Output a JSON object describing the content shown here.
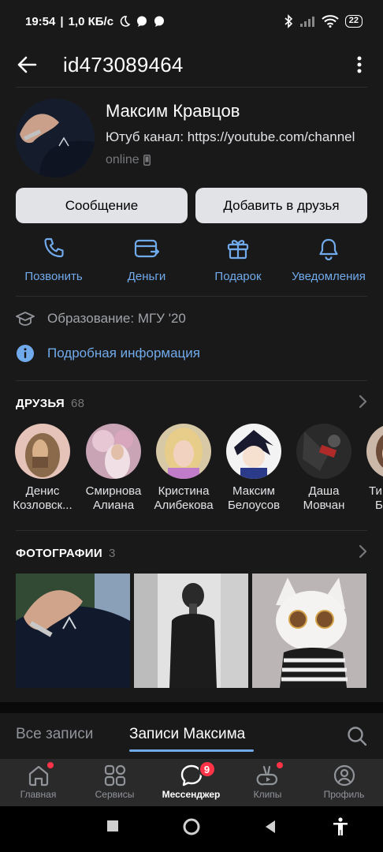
{
  "status_bar": {
    "time": "19:54",
    "speed": "1,0 КБ/с",
    "battery": "22"
  },
  "header": {
    "title": "id473089464"
  },
  "profile": {
    "name": "Максим Кравцов",
    "status": "Ютуб канал: https://youtube.com/channel",
    "online": "online"
  },
  "buttons": {
    "message": "Сообщение",
    "add_friend": "Добавить в друзья"
  },
  "actions": [
    {
      "label": "Позвонить",
      "icon": "phone-icon"
    },
    {
      "label": "Деньги",
      "icon": "money-icon"
    },
    {
      "label": "Подарок",
      "icon": "gift-icon"
    },
    {
      "label": "Уведомления",
      "icon": "bell-icon"
    }
  ],
  "info": {
    "education": "Образование: МГУ '20",
    "details": "Подробная информация"
  },
  "friends_section": {
    "title": "ДРУЗЬЯ",
    "count": "68",
    "items": [
      {
        "first": "Денис",
        "last": "Козловск..."
      },
      {
        "first": "Смирнова",
        "last": "Алиана"
      },
      {
        "first": "Кристина",
        "last": "Алибекова"
      },
      {
        "first": "Максим",
        "last": "Белоусов"
      },
      {
        "first": "Даша",
        "last": "Мовчан"
      },
      {
        "first": "Ти",
        "last": "Б"
      }
    ]
  },
  "photos_section": {
    "title": "ФОТОГРАФИИ",
    "count": "3"
  },
  "tabs": {
    "all": "Все записи",
    "own": "Записи Максима"
  },
  "bottom_nav": [
    {
      "label": "Главная",
      "icon": "home-icon"
    },
    {
      "label": "Сервисы",
      "icon": "services-icon"
    },
    {
      "label": "Мессенджер",
      "icon": "messenger-icon",
      "badge": "9"
    },
    {
      "label": "Клипы",
      "icon": "clips-icon"
    },
    {
      "label": "Профиль",
      "icon": "profile-icon"
    }
  ],
  "colors": {
    "background": "#19191a",
    "accent": "#71aaeb",
    "badge": "#ff3347",
    "button": "#e1e3e6"
  }
}
